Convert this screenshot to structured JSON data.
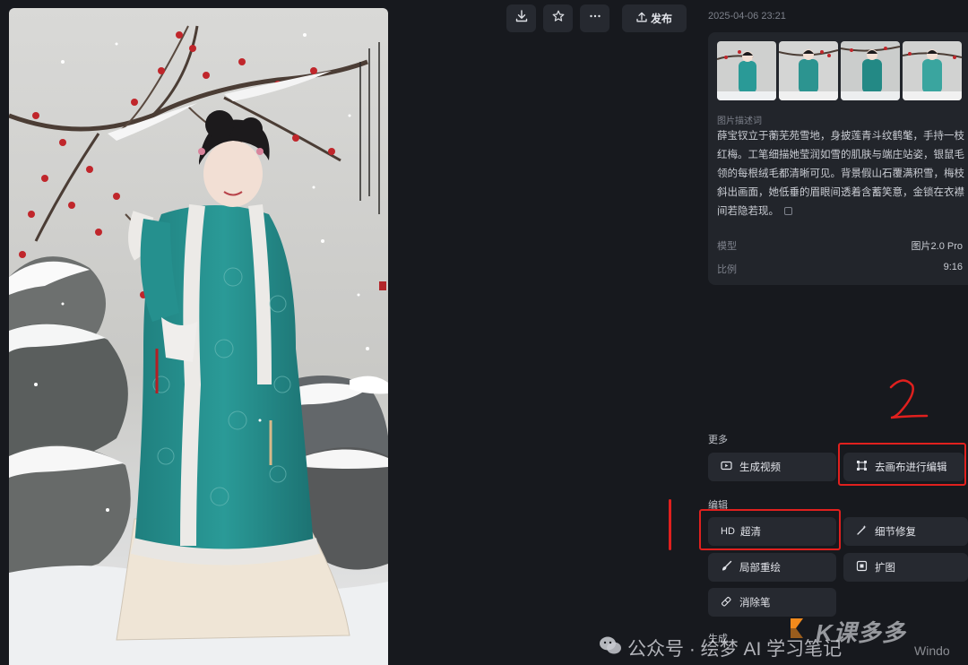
{
  "toolbar": {
    "download_icon": "download-icon",
    "favorite_icon": "star-icon",
    "more_icon": "more-horizontal-icon",
    "publish_label": "发布"
  },
  "detail": {
    "timestamp": "2025-04-06 23:21",
    "description_label": "图片描述词",
    "description": "薛宝钗立于蘅芜苑雪地，身披莲青斗纹鹤氅，手持一枝红梅。工笔细描她莹润如雪的肌肤与端庄站姿，银鼠毛领的每根绒毛都清晰可见。背景假山石覆满积雪，梅枝斜出画面，她低垂的眉眼间透着含蓄笑意，金锁在衣襟间若隐若现。",
    "meta": [
      {
        "key": "模型",
        "value": "图片2.0 Pro"
      },
      {
        "key": "比例",
        "value": "9:16"
      }
    ]
  },
  "sections": {
    "more": {
      "label": "更多",
      "buttons": [
        {
          "label": "生成视频",
          "icon": "video-icon"
        },
        {
          "label": "去画布进行编辑",
          "icon": "canvas-edit-icon"
        }
      ]
    },
    "edit": {
      "label": "编辑",
      "buttons": [
        {
          "label": "超清",
          "badge": "HD",
          "icon": "hd-icon"
        },
        {
          "label": "细节修复",
          "icon": "magic-wand-icon"
        },
        {
          "label": "局部重绘",
          "icon": "brush-icon"
        },
        {
          "label": "扩图",
          "icon": "expand-icon"
        },
        {
          "label": "消除笔",
          "icon": "eraser-icon"
        }
      ]
    },
    "generate": {
      "label": "生成"
    }
  },
  "annotations": {
    "mark_1": "1",
    "mark_2": "2"
  },
  "watermark": {
    "wechat": "公众号 · 绘梦 AI 学习笔记",
    "site": "K课多多",
    "site_small": "Windo"
  },
  "colors": {
    "background": "#17191e",
    "card": "#22252b",
    "button": "#262930",
    "annotation_red": "#e0201e"
  }
}
